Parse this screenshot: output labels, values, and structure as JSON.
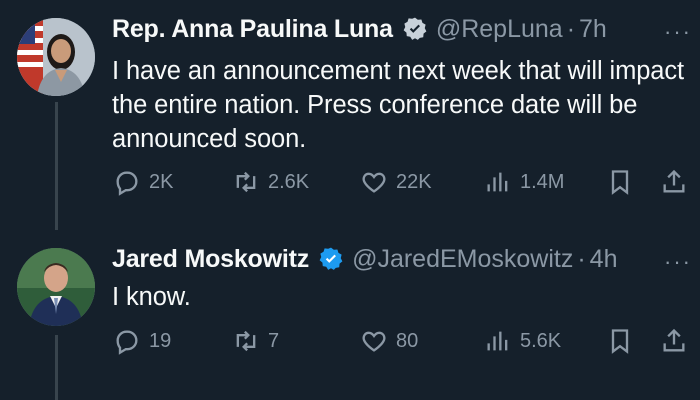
{
  "tweets": [
    {
      "name": "Rep. Anna Paulina Luna",
      "handle": "@RepLuna",
      "separator": "·",
      "time": "7h",
      "more": "···",
      "text": "I have an announcement next week that will impact the entire nation. Press conference date will be announced soon.",
      "replies": "2K",
      "retweets": "2.6K",
      "likes": "22K",
      "views": "1.4M"
    },
    {
      "name": "Jared Moskowitz",
      "handle": "@JaredEMoskowitz",
      "separator": "·",
      "time": "4h",
      "more": "···",
      "text": "I know.",
      "replies": "19",
      "retweets": "7",
      "likes": "80",
      "views": "5.6K"
    }
  ],
  "colors": {
    "background": "#15202b",
    "verified_badge": "#1d9bf0",
    "secondary_text": "#8b98a5"
  },
  "icons": [
    "reply-icon",
    "retweet-icon",
    "like-icon",
    "views-icon",
    "bookmark-icon",
    "share-icon",
    "verified-badge-icon",
    "more-icon"
  ]
}
